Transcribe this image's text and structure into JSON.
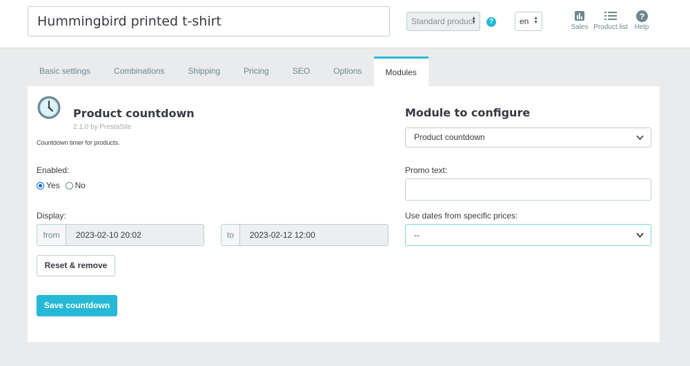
{
  "header": {
    "product_name": "Hummingbird printed t-shirt",
    "product_type": "Standard product",
    "language": "en",
    "tools": [
      {
        "label": "Sales",
        "icon": "bar-chart-icon"
      },
      {
        "label": "Product list",
        "icon": "list-icon"
      },
      {
        "label": "Help",
        "icon": "help-icon"
      }
    ]
  },
  "tabs": [
    {
      "label": "Basic settings"
    },
    {
      "label": "Combinations"
    },
    {
      "label": "Shipping"
    },
    {
      "label": "Pricing"
    },
    {
      "label": "SEO"
    },
    {
      "label": "Options"
    },
    {
      "label": "Modules",
      "active": true
    }
  ],
  "module": {
    "icon": "clock-icon",
    "title": "Product countdown",
    "version": "2.1.0 by PrestaSite",
    "description": "Countdown timer for products.",
    "enabled_label": "Enabled:",
    "yes_label": "Yes",
    "no_label": "No",
    "enabled": "Yes",
    "display_label": "Display:",
    "from_label": "from",
    "from_value": "2023-02-10 20:02",
    "to_label": "to",
    "to_value": "2023-02-12 12:00",
    "reset_label": "Reset & remove",
    "save_label": "Save countdown"
  },
  "configure": {
    "title": "Module to configure",
    "selected_module": "Product countdown",
    "promo_label": "Promo text:",
    "promo_value": "",
    "dates_label": "Use dates from specific prices:",
    "dates_value": "--"
  },
  "colors": {
    "accent": "#25b9d7",
    "radio": "#0067d4"
  }
}
